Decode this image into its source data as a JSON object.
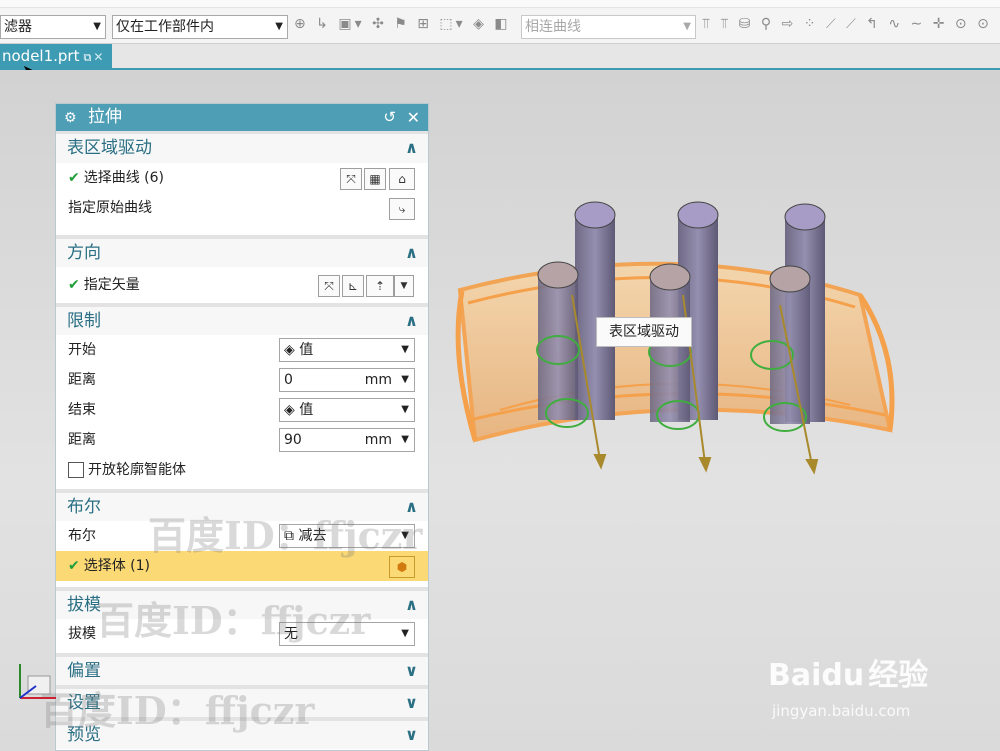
{
  "toolbar": {
    "filter_label": "滤器",
    "scope_select": "仅在工作部件内",
    "curve_rule_select": "相连曲线"
  },
  "tab": {
    "file_name": "nodel1.prt",
    "pin_icon": "pin-icon",
    "close_icon": "close-icon"
  },
  "dialog": {
    "title": "拉伸",
    "section_surface": {
      "title": "表区域驱动",
      "select_curve": "选择曲线 (6)",
      "original_curve": "指定原始曲线"
    },
    "section_direction": {
      "title": "方向",
      "vector": "指定矢量"
    },
    "section_limits": {
      "title": "限制",
      "start_label": "开始",
      "start_value": "值",
      "distance1_label": "距离",
      "distance1_value": "0",
      "distance1_unit": "mm",
      "end_label": "结束",
      "end_value": "值",
      "distance2_label": "距离",
      "distance2_value": "90",
      "distance2_unit": "mm",
      "open_profile": "开放轮廓智能体"
    },
    "section_boolean": {
      "title": "布尔",
      "boolean_label": "布尔",
      "boolean_value": "减去",
      "select_body": "选择体 (1)"
    },
    "section_draft": {
      "title": "拔模",
      "draft_label": "拔模",
      "draft_value": "无"
    },
    "section_offset": {
      "title": "偏置"
    },
    "section_settings": {
      "title": "设置"
    },
    "section_preview": {
      "title": "预览"
    }
  },
  "viewport": {
    "tooltip": "表区域驱动"
  },
  "watermarks": {
    "text": "百度ID：ffjczr"
  },
  "brand": {
    "logo": "Baidu",
    "logo_cn": "经验",
    "url": "jingyan.baidu.com"
  },
  "colors": {
    "accent": "#4e9fb5",
    "selected_row": "#fbd974",
    "check": "#1e9e3a",
    "body_orange": "#f5a04a"
  }
}
